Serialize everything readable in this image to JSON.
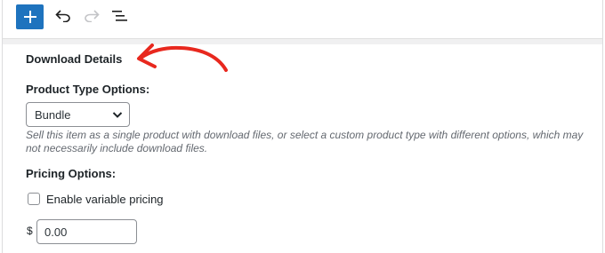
{
  "toolbar": {
    "add_icon": "plus-icon",
    "undo_icon": "undo-icon",
    "redo_icon": "redo-icon",
    "list_view_icon": "list-view-icon",
    "accent_color": "#1e73be"
  },
  "section": {
    "title": "Download Details"
  },
  "product_type": {
    "label": "Product Type Options:",
    "selected": "Bundle",
    "description": "Sell this item as a single product with download files, or select a custom product type with different options, which may not necessarily include download files."
  },
  "pricing": {
    "label": "Pricing Options:",
    "variable_pricing_label": "Enable variable pricing",
    "variable_pricing_checked": false,
    "currency_symbol": "$",
    "price_value": "0.00"
  },
  "annotation": {
    "arrow_color": "#e8281e"
  }
}
